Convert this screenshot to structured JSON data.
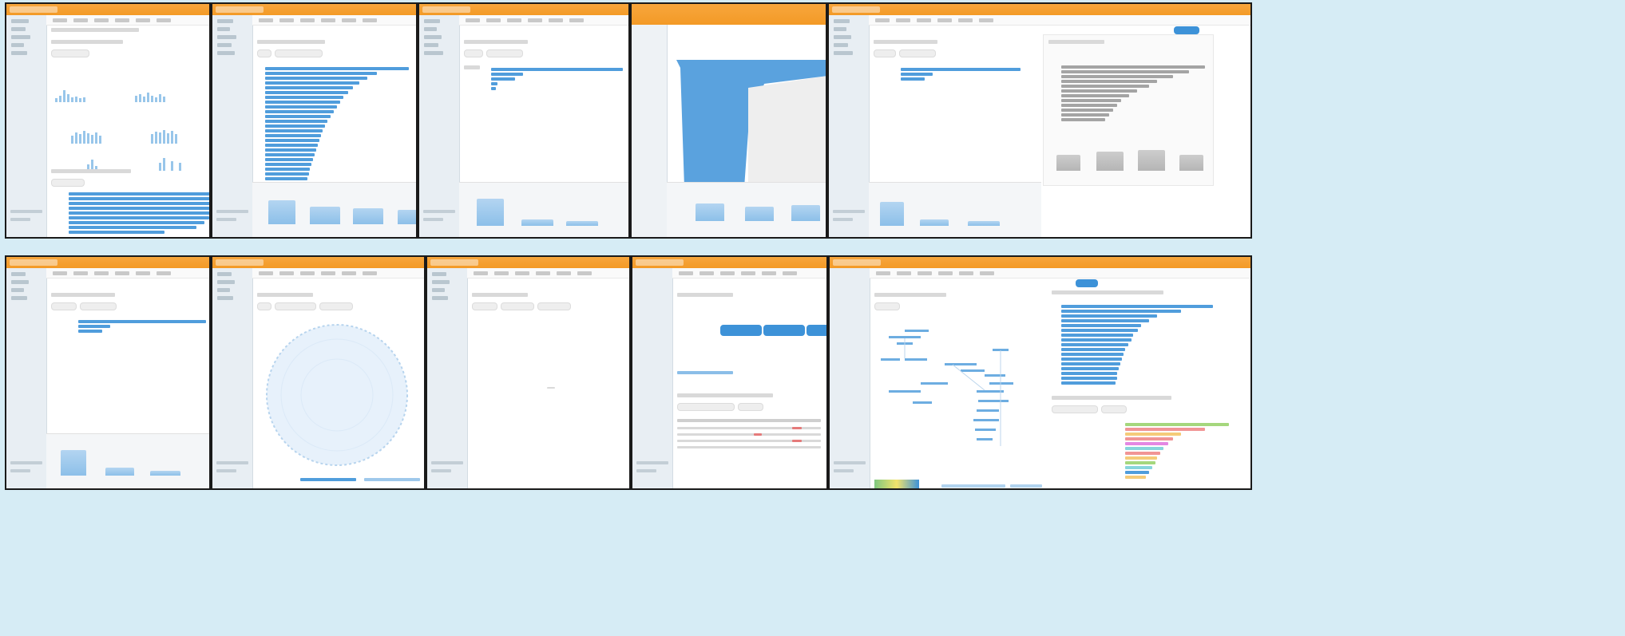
{
  "grid": {
    "rows": 2,
    "columns_per_row": 5
  },
  "colors": {
    "background": "#d6ecf5",
    "accent_orange": "#f39a26",
    "bar_blue": "#3d92d8",
    "frame_border": "#1a1a1a",
    "sidebar": "#e8eef3"
  },
  "panels": [
    {
      "id": "top-1",
      "view": "bar-and-histogram-dashboard"
    },
    {
      "id": "top-2",
      "view": "long-bar-list"
    },
    {
      "id": "top-3",
      "view": "short-bar-list"
    },
    {
      "id": "top-4",
      "view": "zoomed-histogram"
    },
    {
      "id": "top-5",
      "view": "bar-list-with-grey-detail"
    },
    {
      "id": "bottom-1",
      "view": "short-bar-list"
    },
    {
      "id": "bottom-2",
      "view": "circular-network"
    },
    {
      "id": "bottom-3",
      "view": "empty-view"
    },
    {
      "id": "bottom-4",
      "view": "table-with-buttons"
    },
    {
      "id": "bottom-5",
      "view": "tree-and-colored-bars"
    }
  ]
}
